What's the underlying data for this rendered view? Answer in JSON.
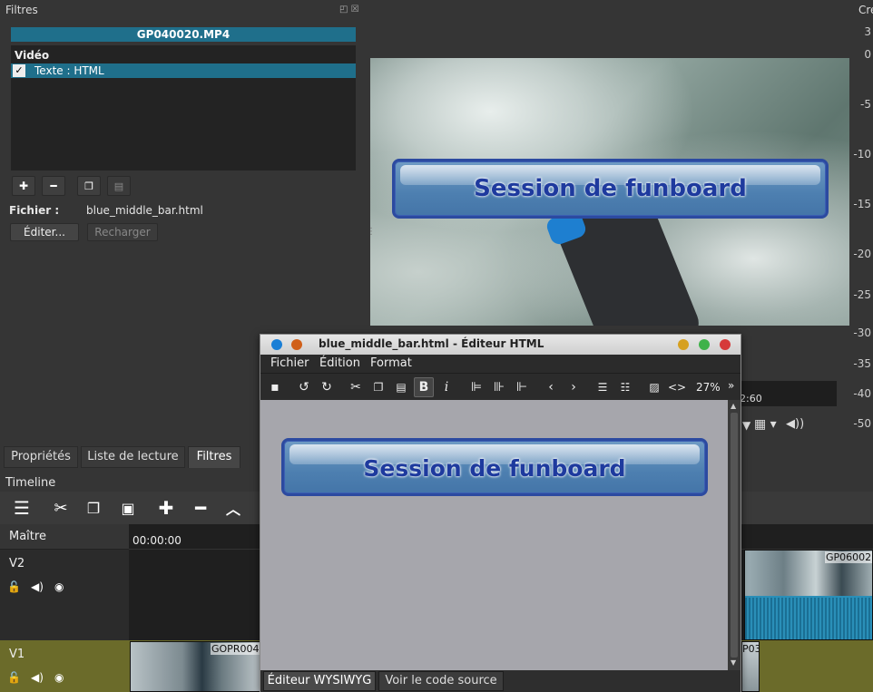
{
  "filters": {
    "title": "Filtres",
    "clip_name": "GP040020.MP4",
    "section": "Vidéo",
    "filter_item": "Texte : HTML",
    "file_label": "Fichier :",
    "file_value": "blue_middle_bar.html",
    "edit_button": "Éditer...",
    "reload_button": "Recharger"
  },
  "preview": {
    "overlay_text": "Session de funboard",
    "time_fragment": "2:60"
  },
  "right_panel": {
    "title_fragment": "Cre",
    "scale": [
      "3",
      "0",
      "-5",
      "-10",
      "-15",
      "-20",
      "-25",
      "-30",
      "-35",
      "-40",
      "-50"
    ]
  },
  "dock_tabs": [
    "Propriétés",
    "Liste de lecture",
    "Filtres"
  ],
  "timeline": {
    "title": "Timeline",
    "master": "Maître",
    "v2": "V2",
    "v1": "V1",
    "timecode": "00:00:00",
    "clips": {
      "v1_a": "GOPR004",
      "v1_b": "P03",
      "v2_a": "GP06002"
    }
  },
  "editor": {
    "window_title": "blue_middle_bar.html - Éditeur HTML",
    "menu": [
      "Fichier",
      "Édition",
      "Format"
    ],
    "zoom": "27%",
    "overlay_text": "Session de funboard",
    "tab_wysiwyg": "Éditeur WYSIWYG",
    "tab_source": "Voir le code source"
  },
  "colors": {
    "accent": "#1f6f8b",
    "v1_track": "#6b6b2a",
    "bar_border": "#2c4aa0",
    "dot_blue": "#1a7fd6",
    "dot_orange": "#d0601a",
    "dot_yellow": "#d6a020",
    "dot_green": "#3fb24a",
    "dot_red": "#d63a3a"
  }
}
